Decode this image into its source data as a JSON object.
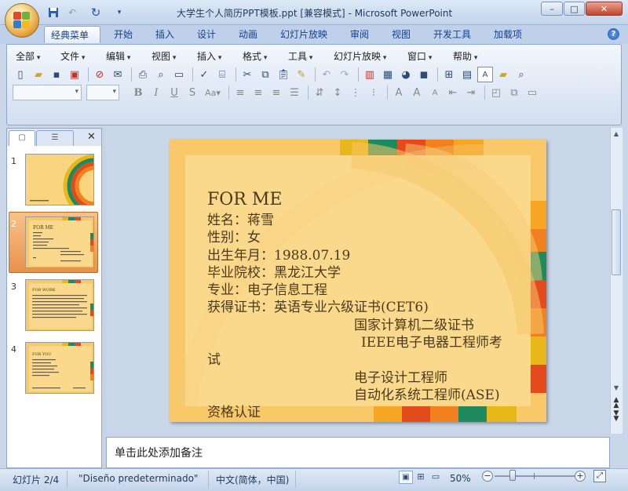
{
  "window": {
    "title": "大学生个人简历PPT模板.ppt [兼容模式] - Microsoft PowerPoint",
    "minimize": "–",
    "maximize": "□",
    "close": "✕"
  },
  "quick_access": [
    {
      "icon": "save-icon",
      "glyph": "▪"
    },
    {
      "icon": "undo-icon",
      "glyph": "↶"
    },
    {
      "icon": "redo-icon",
      "glyph": "↻"
    },
    {
      "icon": "customize-icon",
      "glyph": "▾"
    }
  ],
  "ribbon_tabs": [
    "经典菜单",
    "开始",
    "插入",
    "设计",
    "动画",
    "幻灯片放映",
    "审阅",
    "视图",
    "开发工具",
    "加载项"
  ],
  "active_tab": "经典菜单",
  "classic_menus": [
    "全部",
    "文件",
    "编辑",
    "视图",
    "插入",
    "格式",
    "工具",
    "幻灯片放映",
    "窗口",
    "帮助"
  ],
  "left_panel": {
    "tabs": [
      {
        "icon": "slides-tab-icon",
        "glyph": "▢"
      },
      {
        "icon": "outline-tab-icon",
        "glyph": "☰"
      }
    ],
    "close": "✕",
    "thumbnails": [
      {
        "num": "1"
      },
      {
        "num": "2",
        "selected": true,
        "title": "FOR ME"
      },
      {
        "num": "3",
        "title": "FOR WORK"
      },
      {
        "num": "4",
        "title": "FOR YOU"
      }
    ]
  },
  "slide": {
    "heading": "FOR ME",
    "lines": [
      "姓名：蒋雪",
      "性别：女",
      "出生年月：1988.07.19",
      "毕业院校：黑龙江大学",
      "专业：电子信息工程",
      "获得证书：英语专业六级证书(CET6)"
    ],
    "indented_lines": [
      "国家计算机二级证书",
      "IEEE电子电器工程师考"
    ],
    "wrap_line": "试",
    "indented_lines_2": [
      "电子设计工程师",
      "自动化系统工程师(ASE)"
    ],
    "last_line": "资格认证"
  },
  "notes": {
    "placeholder": "单击此处添加备注"
  },
  "status": {
    "slide_info": "幻灯片 2/4",
    "theme": "\"Diseño predeterminado\"",
    "language": "中文(简体，中国)",
    "zoom": "50%",
    "zoom_fraction": 0.5
  },
  "colors": {
    "slide_bg": "#f9c868",
    "rainbow": [
      "#e8b81a",
      "#1f8a5e",
      "#e34a1c",
      "#f1801e",
      "#f5a623"
    ]
  }
}
